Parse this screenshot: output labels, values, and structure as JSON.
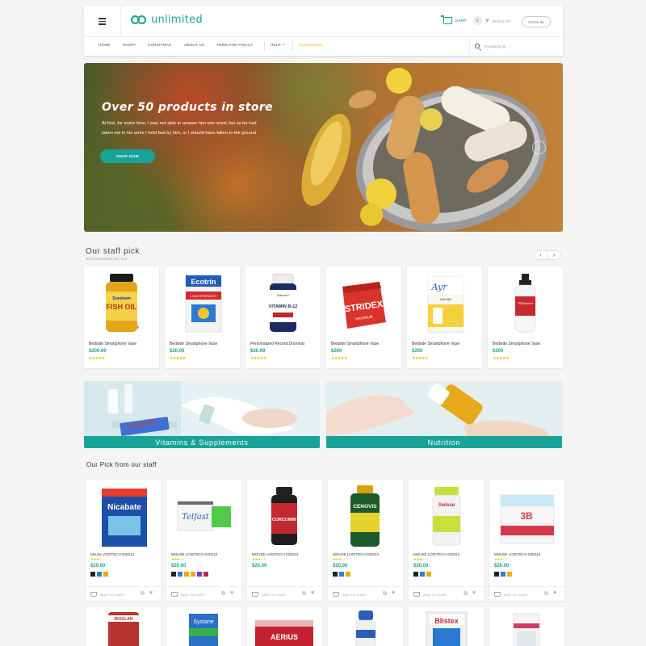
{
  "header": {
    "logo_text": "unlimited",
    "cart_label": "CART",
    "cart_count": "0",
    "wishlist_label": "WISHLIST",
    "signin_label": "SIGN IN",
    "nav": [
      "HOME",
      "SHOP",
      "CHRISTMAS",
      "ABOUT US",
      "TERM AND POLICY",
      "HELP",
      "#LOOKBOOK"
    ],
    "search_placeholder": "I'm looking for ..."
  },
  "hero": {
    "title": "Over 50 products in store",
    "text": "At first, for some time, I was not able to answer him one word; but as he had taken me in his arms I held fast by him, or I should have fallen to the ground.",
    "button": "SHOP NOW"
  },
  "staff_pick": {
    "title": "Our staff pick",
    "subtitle": "Recommended for You",
    "products": [
      {
        "name": "Bedside Smartphone Vase",
        "price": "$200.00",
        "stars": "★★★★★",
        "brand": "FISH OIL",
        "top": "Sundown"
      },
      {
        "name": "Bedside Smartphone Vase",
        "price": "$20.00",
        "stars": "★★★★★",
        "brand": "Ecotrin",
        "top": "LOW STRENGTH"
      },
      {
        "name": "Personalized Record Doormat",
        "price": "$30.99",
        "stars": "★★★★★",
        "brand": "VITAMIN B-12",
        "top": "Nature's"
      },
      {
        "name": "Bedside Smartphone Vase",
        "price": "$200",
        "stars": "★★★★★",
        "brand": "STRIDEX",
        "top": "MAXIMUM"
      },
      {
        "name": "Bedside Smartphone Vase",
        "price": "$200",
        "stars": "★★★★★",
        "brand": "Ayr",
        "top": "SALINE"
      },
      {
        "name": "Bedside Smartphone Vase",
        "price": "$200",
        "stars": "★★★★★",
        "brand": "TRESemmé",
        "top": ""
      }
    ]
  },
  "categories": [
    {
      "label": "Vitamins & Supplements"
    },
    {
      "label": "Nutrition"
    }
  ],
  "our_pick": {
    "title": "Our Pick from our staff",
    "add_to_cart": "ADD TO CART",
    "products": [
      {
        "name": "Mouse LOGITECH 020313",
        "price": "$20.00",
        "stars": "★★★☆☆",
        "brand": "Nicabate",
        "swatches": [
          "#222222",
          "#2f7fd0",
          "#f2a900"
        ]
      },
      {
        "name": "MOUSE LOGITECH 020313",
        "price": "$20.00",
        "stars": "★★★☆☆",
        "brand": "Telfast",
        "swatches": [
          "#222222",
          "#2f7fd0",
          "#f2a900",
          "#f2a900",
          "#7c3fbf",
          "#c4215b"
        ]
      },
      {
        "name": "MOUSE LOGITECH 020313",
        "price": "$20.00",
        "stars": "★★★☆☆",
        "brand": "CURCUMIN",
        "swatches": []
      },
      {
        "name": "MOUSE LOGITECH 020313",
        "price": "$20.00",
        "stars": "★★★☆☆",
        "brand": "CENOVIS",
        "swatches": [
          "#222222",
          "#2f7fd0",
          "#f2a900"
        ]
      },
      {
        "name": "MOUSE LOGITECH 020313",
        "price": "$20.00",
        "stars": "★★★☆☆",
        "brand": "Swisse",
        "swatches": [
          "#222222",
          "#2f7fd0",
          "#f2a900"
        ]
      },
      {
        "name": "MOUSE LOGITECH 020313",
        "price": "$20.00",
        "stars": "★★★☆☆",
        "brand": "3B",
        "swatches": [
          "#222222",
          "#2f7fd0",
          "#f2a900"
        ]
      }
    ],
    "next_row": [
      "BIOGLAN",
      "Systane",
      "AERIUS",
      "",
      "Blistex",
      ""
    ]
  },
  "colors": {
    "accent": "#17a398",
    "price": "#17a398",
    "star": "#f4b400",
    "lookbook": "#f4b400"
  }
}
